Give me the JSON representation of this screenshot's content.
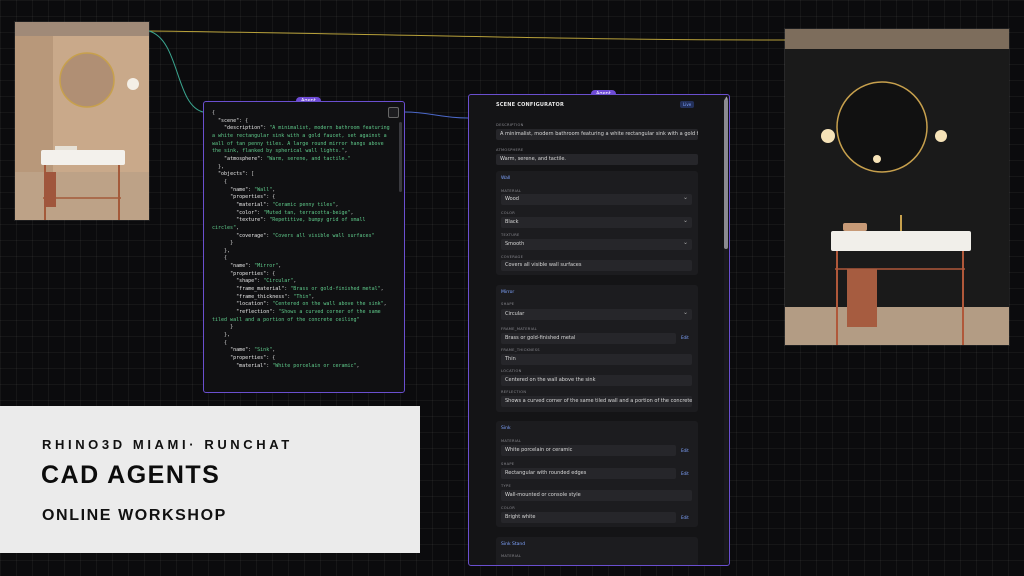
{
  "colors": {
    "accent": "#6a4fcf",
    "wire_yellow": "#b8a13a",
    "wire_teal": "#3aa58f",
    "wire_blue": "#4b68c9"
  },
  "json_node": {
    "tag": "Agent",
    "lines": [
      [
        [
          "p",
          "{"
        ]
      ],
      [
        [
          "p",
          "  "
        ],
        [
          "k",
          "\"scene\""
        ],
        [
          "p",
          ": {"
        ]
      ],
      [
        [
          "p",
          "    "
        ],
        [
          "k",
          "\"description\""
        ],
        [
          "p",
          ": "
        ],
        [
          "s",
          "\"A minimalist, modern bathroom featuring a white rectangular sink with a gold faucet, set against a wall of tan penny tiles. A large round mirror hangs above the sink, flanked by spherical wall lights.\""
        ],
        [
          "p",
          ","
        ]
      ],
      [
        [
          "p",
          "    "
        ],
        [
          "k",
          "\"atmosphere\""
        ],
        [
          "p",
          ": "
        ],
        [
          "s",
          "\"Warm, serene, and tactile.\""
        ]
      ],
      [
        [
          "p",
          "  },"
        ]
      ],
      [
        [
          "p",
          "  "
        ],
        [
          "k",
          "\"objects\""
        ],
        [
          "p",
          ": ["
        ]
      ],
      [
        [
          "p",
          "    {"
        ]
      ],
      [
        [
          "p",
          "      "
        ],
        [
          "k",
          "\"name\""
        ],
        [
          "p",
          ": "
        ],
        [
          "s",
          "\"Wall\""
        ],
        [
          "p",
          ","
        ]
      ],
      [
        [
          "p",
          "      "
        ],
        [
          "k",
          "\"properties\""
        ],
        [
          "p",
          ": {"
        ]
      ],
      [
        [
          "p",
          "        "
        ],
        [
          "k",
          "\"material\""
        ],
        [
          "p",
          ": "
        ],
        [
          "s",
          "\"Ceramic penny tiles\""
        ],
        [
          "p",
          ","
        ]
      ],
      [
        [
          "p",
          "        "
        ],
        [
          "k",
          "\"color\""
        ],
        [
          "p",
          ": "
        ],
        [
          "s",
          "\"Muted tan, terracotta-beige\""
        ],
        [
          "p",
          ","
        ]
      ],
      [
        [
          "p",
          "        "
        ],
        [
          "k",
          "\"texture\""
        ],
        [
          "p",
          ": "
        ],
        [
          "s",
          "\"Repetitive, bumpy grid of small circles\""
        ],
        [
          "p",
          ","
        ]
      ],
      [
        [
          "p",
          "        "
        ],
        [
          "k",
          "\"coverage\""
        ],
        [
          "p",
          ": "
        ],
        [
          "s",
          "\"Covers all visible wall surfaces\""
        ]
      ],
      [
        [
          "p",
          "      }"
        ]
      ],
      [
        [
          "p",
          "    },"
        ]
      ],
      [
        [
          "p",
          "    {"
        ]
      ],
      [
        [
          "p",
          "      "
        ],
        [
          "k",
          "\"name\""
        ],
        [
          "p",
          ": "
        ],
        [
          "s",
          "\"Mirror\""
        ],
        [
          "p",
          ","
        ]
      ],
      [
        [
          "p",
          "      "
        ],
        [
          "k",
          "\"properties\""
        ],
        [
          "p",
          ": {"
        ]
      ],
      [
        [
          "p",
          "        "
        ],
        [
          "k",
          "\"shape\""
        ],
        [
          "p",
          ": "
        ],
        [
          "s",
          "\"Circular\""
        ],
        [
          "p",
          ","
        ]
      ],
      [
        [
          "p",
          "        "
        ],
        [
          "k",
          "\"frame_material\""
        ],
        [
          "p",
          ": "
        ],
        [
          "s",
          "\"Brass or gold-finished metal\""
        ],
        [
          "p",
          ","
        ]
      ],
      [
        [
          "p",
          "        "
        ],
        [
          "k",
          "\"frame_thickness\""
        ],
        [
          "p",
          ": "
        ],
        [
          "s",
          "\"Thin\""
        ],
        [
          "p",
          ","
        ]
      ],
      [
        [
          "p",
          "        "
        ],
        [
          "k",
          "\"location\""
        ],
        [
          "p",
          ": "
        ],
        [
          "s",
          "\"Centered on the wall above the sink\""
        ],
        [
          "p",
          ","
        ]
      ],
      [
        [
          "p",
          "        "
        ],
        [
          "k",
          "\"reflection\""
        ],
        [
          "p",
          ": "
        ],
        [
          "s",
          "\"Shows a curved corner of the same tiled wall and a portion of the concrete ceiling\""
        ]
      ],
      [
        [
          "p",
          "      }"
        ]
      ],
      [
        [
          "p",
          "    },"
        ]
      ],
      [
        [
          "p",
          "    {"
        ]
      ],
      [
        [
          "p",
          "      "
        ],
        [
          "k",
          "\"name\""
        ],
        [
          "p",
          ": "
        ],
        [
          "s",
          "\"Sink\""
        ],
        [
          "p",
          ","
        ]
      ],
      [
        [
          "p",
          "      "
        ],
        [
          "k",
          "\"properties\""
        ],
        [
          "p",
          ": {"
        ]
      ],
      [
        [
          "p",
          "        "
        ],
        [
          "k",
          "\"material\""
        ],
        [
          "p",
          ": "
        ],
        [
          "s",
          "\"White porcelain or ceramic\""
        ],
        [
          "p",
          ","
        ]
      ]
    ]
  },
  "config": {
    "tag": "Agent",
    "title": "SCENE CONFIGURATOR",
    "live_badge": "Live",
    "description_label": "DESCRIPTION",
    "description_value": "A minimalist, modern bathroom featuring a white rectangular sink with a gold fa",
    "atmosphere_label": "ATMOSPHERE",
    "atmosphere_value": "Warm, serene, and tactile.",
    "edit_label": "Edit",
    "sections": {
      "wall": {
        "title": "Wall",
        "material_label": "MATERIAL",
        "material": "Wood",
        "color_label": "COLOR",
        "color": "Black",
        "texture_label": "TEXTURE",
        "texture": "Smooth",
        "coverage_label": "COVERAGE",
        "coverage": "Covers all visible wall surfaces"
      },
      "mirror": {
        "title": "Mirror",
        "shape_label": "SHAPE",
        "shape": "Circular",
        "frame_material_label": "FRAME_MATERIAL",
        "frame_material": "Brass or gold-finished metal",
        "frame_thickness_label": "FRAME_THICKNESS",
        "frame_thickness": "Thin",
        "location_label": "LOCATION",
        "location": "Centered on the wall above the sink",
        "reflection_label": "REFLECTION",
        "reflection": "Shows a curved corner of the same tiled wall and a portion of the concrete"
      },
      "sink": {
        "title": "Sink",
        "material_label": "MATERIAL",
        "material": "White porcelain or ceramic",
        "shape_label": "SHAPE",
        "shape": "Rectangular with rounded edges",
        "type_label": "TYPE",
        "type": "Wall-mounted or console style",
        "color_label": "COLOR",
        "color": "Bright white"
      },
      "sink_stand": {
        "title": "Sink Stand",
        "material_label": "MATERIAL"
      }
    }
  },
  "workshop": {
    "org": "RHINO3D MIAMI· RUNCHAT",
    "title": "CAD AGENTS",
    "subtitle": "ONLINE WORKSHOP"
  }
}
